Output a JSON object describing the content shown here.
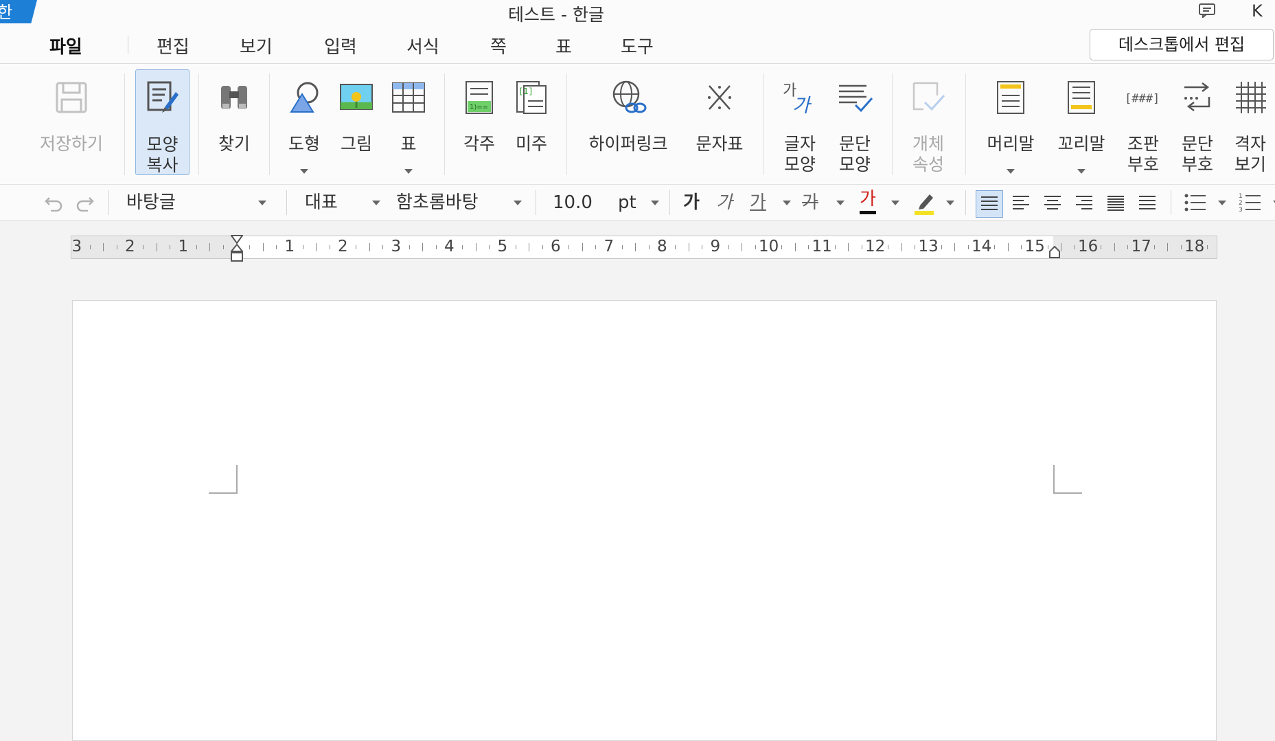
{
  "titlebar": {
    "logo_glyph": "한",
    "title": "테스트 - 한글",
    "user_initial": "K",
    "comment_icon": "comment-icon"
  },
  "menu": {
    "items": [
      "파일",
      "편집",
      "보기",
      "입력",
      "서식",
      "쪽",
      "표",
      "도구"
    ],
    "active": "파일",
    "desktop_edit": "데스크톱에서 편집"
  },
  "ribbon": {
    "save": "저장하기",
    "format_copy": [
      "모양",
      "복사"
    ],
    "find": "찾기",
    "shape": "도형",
    "picture": "그림",
    "table": "표",
    "footnote": "각주",
    "endnote": "미주",
    "hyperlink": "하이퍼링크",
    "charmap": "문자표",
    "char_shape": [
      "글자",
      "모양"
    ],
    "para_shape": [
      "문단",
      "모양"
    ],
    "object_props": [
      "개체",
      "속성"
    ],
    "header": "머리말",
    "footer": "꼬리말",
    "layout_marks": [
      "조판",
      "부호"
    ],
    "para_marks": [
      "문단",
      "부호"
    ],
    "grid_view": [
      "격자",
      "보기"
    ]
  },
  "format": {
    "style": "바탕글",
    "font_lang": "대표",
    "font": "함초롬바탕",
    "size": "10.0",
    "unit": "pt",
    "bold": "가",
    "italic": "가",
    "underline": "가",
    "strike": "가",
    "font_color": "가",
    "colors": {
      "font_color": "#d0231c",
      "highlight": "#f2e125",
      "accent": "#1e7fd6"
    }
  },
  "ruler": {
    "left_labels": [
      "3",
      "2",
      "1"
    ],
    "right_labels": [
      "1",
      "2",
      "3",
      "4",
      "5",
      "6",
      "7",
      "8",
      "9",
      "10",
      "11",
      "12",
      "13",
      "14",
      "15",
      "16",
      "17",
      "18"
    ]
  }
}
